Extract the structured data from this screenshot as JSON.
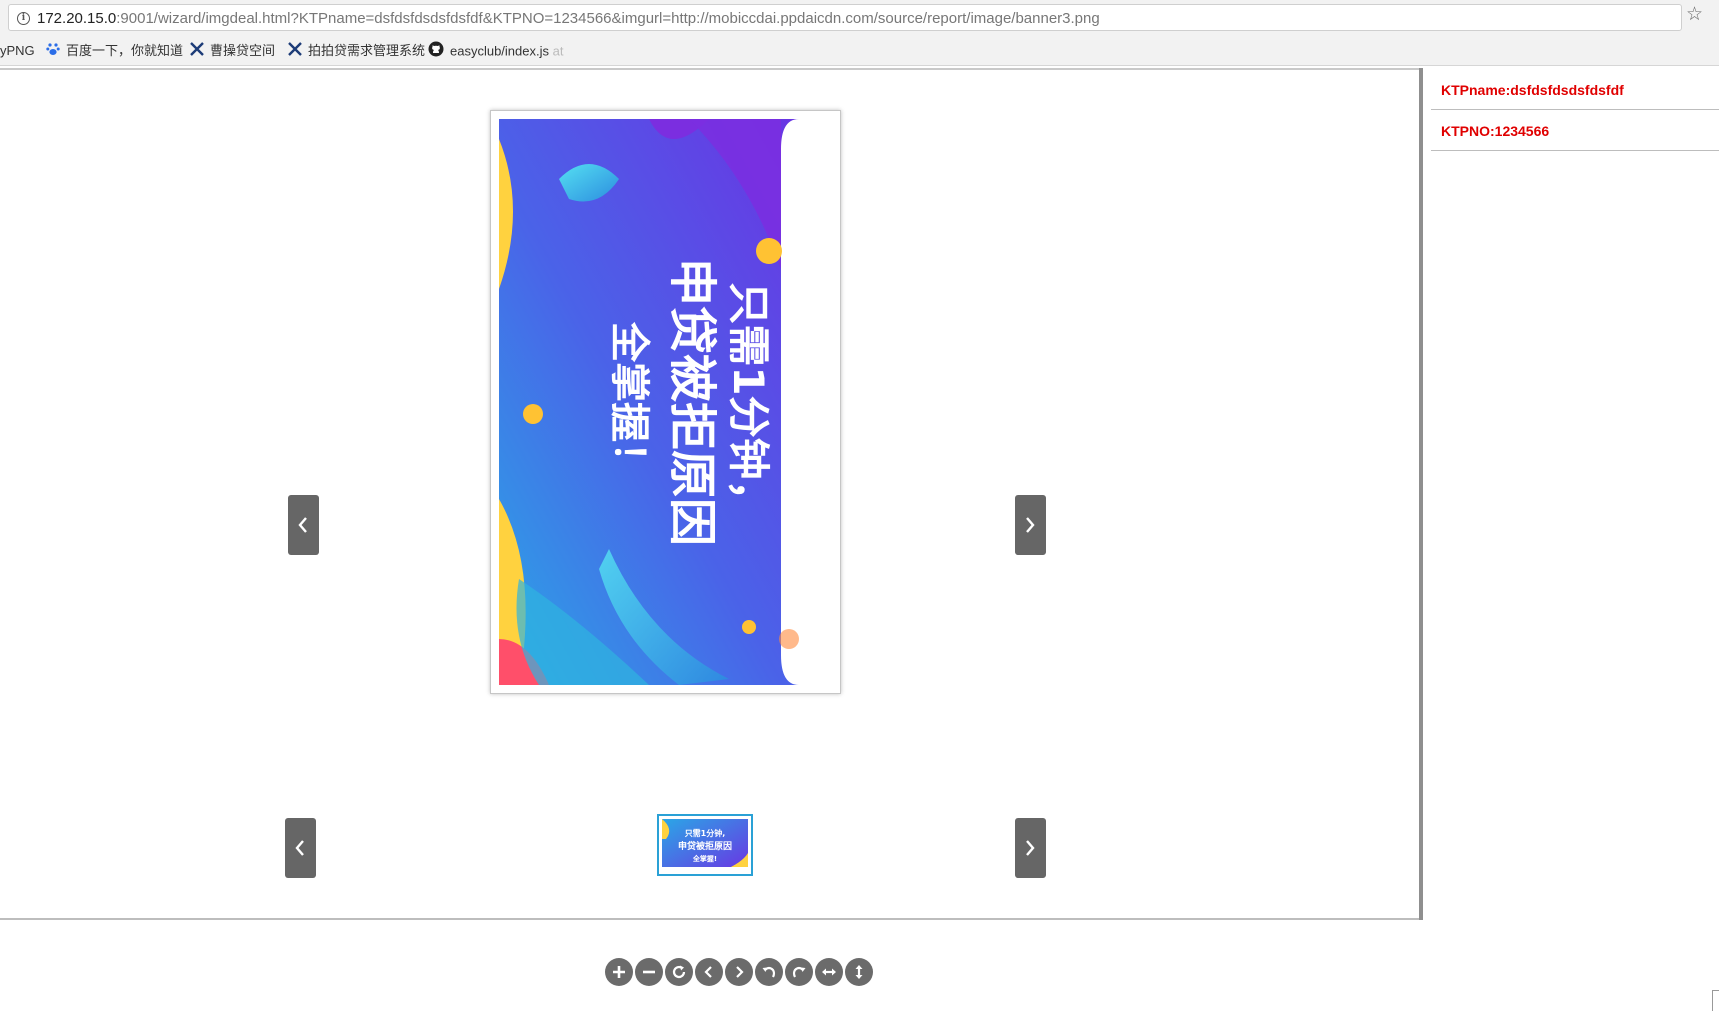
{
  "browser": {
    "url_host": "172.20.15.0",
    "url_rest": ":9001/wizard/imgdeal.html?KTPname=dsfdsfdsdsfdsfdf&KTPNO=1234566&imgurl=http://mobiccdai.ppdaicdn.com/source/report/image/banner3.png",
    "bookmarks": [
      {
        "label": "yPNG",
        "icon": "none"
      },
      {
        "label": "百度一下，你就知道",
        "icon": "baidu-paw-icon"
      },
      {
        "label": "曹操贷空间",
        "icon": "atlassian-x-icon"
      },
      {
        "label": "拍拍贷需求管理系统",
        "icon": "atlassian-x-icon"
      },
      {
        "label": "easyclub/index.js",
        "icon": "github-icon"
      },
      {
        "label": "at"
      }
    ]
  },
  "side_panel": {
    "ktp_name": "KTPname:dsfdsfdsdsfdsfdf",
    "ktp_no": "KTPNO:1234566"
  },
  "banner": {
    "line1": "只需1分钟，",
    "line2": "申贷被拒原因",
    "line3": "全掌握！",
    "thumb_line1": "只需1分钟,",
    "thumb_line2": "申贷被拒原因",
    "thumb_line3": "全掌握!"
  },
  "toolbar": {
    "buttons": [
      "zoom-in-icon",
      "zoom-out-icon",
      "reset-icon",
      "prev-icon",
      "next-icon",
      "rotate-left-icon",
      "rotate-right-icon",
      "flip-horizontal-icon",
      "flip-vertical-icon"
    ]
  },
  "colors": {
    "accent_red": "#e00000",
    "nav_gray": "#666666",
    "thumb_border": "#2aa1d6"
  }
}
